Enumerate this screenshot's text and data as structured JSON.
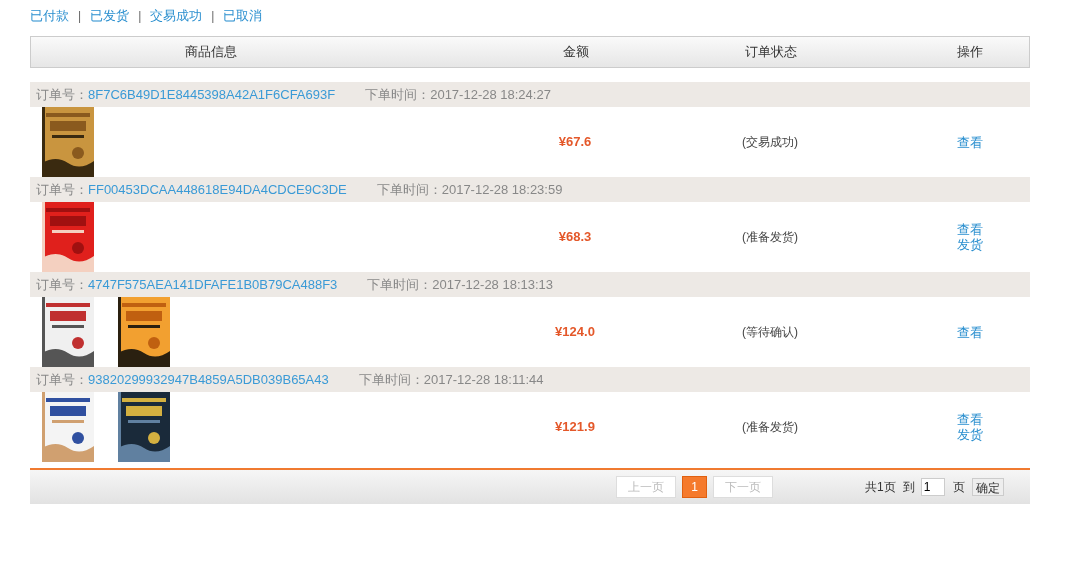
{
  "filters": {
    "separator": "|",
    "links": [
      "已付款",
      "已发货",
      "交易成功",
      "已取消"
    ]
  },
  "table": {
    "columns": [
      "商品信息",
      "金额",
      "订单状态",
      "操作"
    ],
    "orders": [
      {
        "order_label": "订单号：",
        "order_id": "8F7C6B49D1E8445398A42A1F6CFA693F",
        "time": "下单时间：2017-12-28 18:24:27",
        "items": [
          {
            "kind": "picture"
          }
        ],
        "amount": "¥67.6",
        "status": "(交易成功)",
        "actions": [
          "查看"
        ]
      },
      {
        "order_label": "订单号：",
        "order_id": "FF00453DCAA448618E94DA4CDCE9C3DE",
        "time": "下单时间：2017-12-28 18:23:59",
        "items": [
          {
            "kind": "picture"
          }
        ],
        "amount": "¥68.3",
        "status": "(准备发货)",
        "actions": [
          "查看",
          "发货"
        ]
      },
      {
        "order_label": "订单号：",
        "order_id": "4747F575AEA141DFAFE1B0B79CA488F3",
        "time": "下单时间：2017-12-28 18:13:13",
        "items": [
          {
            "kind": "picture"
          },
          {
            "kind": "picture"
          }
        ],
        "amount": "¥124.0",
        "status": "(等待确认)",
        "actions": [
          "查看"
        ]
      },
      {
        "order_label": "订单号：",
        "order_id": "93820299932947B4859A5DB039B65A43",
        "time": "下单时间：2017-12-28 18:11:44",
        "items": [
          {
            "kind": "picture"
          },
          {
            "kind": "picture"
          }
        ],
        "amount": "¥121.9",
        "status": "(准备发货)",
        "actions": [
          "查看",
          "发货"
        ]
      }
    ]
  },
  "pagination": {
    "prev": {
      "label": "上一页",
      "disabled": true
    },
    "pages": [
      {
        "label": "1",
        "selected": true
      }
    ],
    "next": {
      "label": "下一页",
      "disabled": true
    },
    "total": "共1页",
    "goto": "到",
    "page_input": "1",
    "page_unit": "页",
    "confirm": "确定"
  }
}
